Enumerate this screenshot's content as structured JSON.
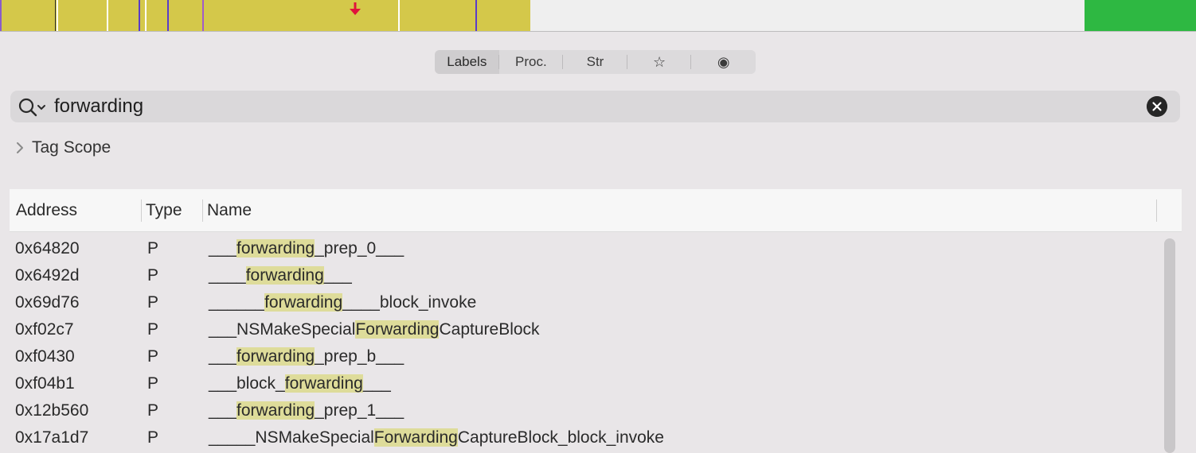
{
  "navbar": {
    "colors": {
      "code": "#d4c84a",
      "empty": "#efefef",
      "data": "#2eb842"
    }
  },
  "tabs": [
    {
      "label": "Labels",
      "selected": true
    },
    {
      "label": "Proc.",
      "selected": false
    },
    {
      "label": "Str",
      "selected": false
    },
    {
      "label": "☆",
      "icon": "star-icon",
      "selected": false
    },
    {
      "label": "◉",
      "icon": "radio-dot-icon",
      "selected": false
    }
  ],
  "search": {
    "value": "forwarding",
    "highlight_color": "#dedc9a"
  },
  "tag_scope": {
    "label": "Tag Scope"
  },
  "table": {
    "columns": [
      "Address",
      "Type",
      "Name"
    ],
    "rows": [
      {
        "address": "0x64820",
        "type": "P",
        "name": "___forwarding_prep_0___"
      },
      {
        "address": "0x6492d",
        "type": "P",
        "name": "____forwarding___"
      },
      {
        "address": "0x69d76",
        "type": "P",
        "name": "______forwarding____block_invoke"
      },
      {
        "address": "0xf02c7",
        "type": "P",
        "name": "___NSMakeSpecialForwardingCaptureBlock"
      },
      {
        "address": "0xf0430",
        "type": "P",
        "name": "___forwarding_prep_b___"
      },
      {
        "address": "0xf04b1",
        "type": "P",
        "name": "___block_forwarding___"
      },
      {
        "address": "0x12b560",
        "type": "P",
        "name": "___forwarding_prep_1___"
      },
      {
        "address": "0x17a1d7",
        "type": "P",
        "name": "_____NSMakeSpecialForwardingCaptureBlock_block_invoke"
      }
    ]
  }
}
